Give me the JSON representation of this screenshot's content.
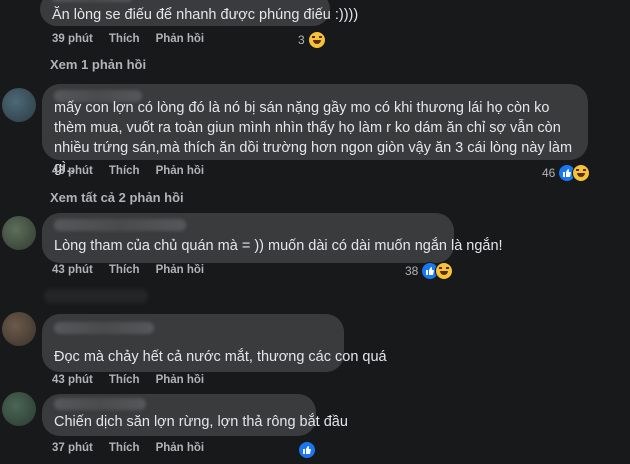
{
  "labels": {
    "like": "Thích",
    "reply": "Phản hồi"
  },
  "comments": [
    {
      "text": "Ăn lòng se điếu để nhanh được phúng điếu :))))",
      "time": "39 phút",
      "reactions": "3"
    },
    {
      "text": "mấy con lợn có lòng đó là nó bị sán nặng gầy mo có khi thương lái họ còn ko thèm mua, vuốt ra toàn giun mình nhìn thấy họ làm r ko dám ăn chỉ sợ vẫn còn nhiều trứng sán,mà thích ăn dồi trường hơn ngon giòn vậy ăn 3 cái lòng này làm gì..",
      "time": "43 phút",
      "reactions": "46"
    },
    {
      "text": "Lòng tham của chủ quán mà = )) muốn dài có dài muốn ngắn là ngắn!",
      "time": "43 phút",
      "reactions": "38"
    },
    {
      "text": "Đọc mà chảy hết cả nước mắt, thương các con quá",
      "time": "43 phút",
      "reactions": ""
    },
    {
      "text": "Chiến dịch săn lợn rừng, lợn thả rông bắt đầu",
      "time": "37 phút",
      "reactions": ""
    }
  ],
  "replies": {
    "view_one": "Xem 1 phản hồi",
    "view_all": "Xem tất cả 2 phản hồi"
  }
}
